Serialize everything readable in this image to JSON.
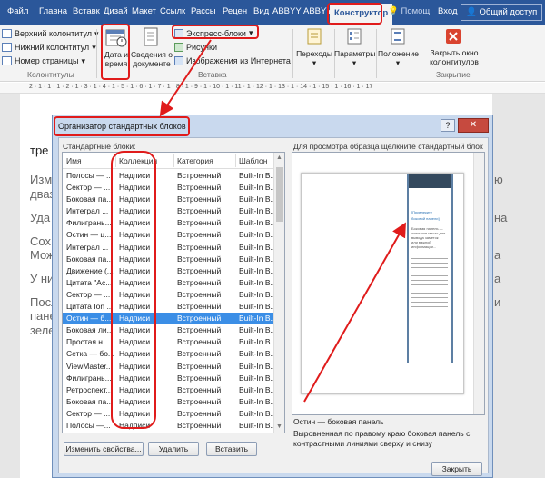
{
  "ribbon_tabs": [
    "Файл",
    "Главна",
    "Вставк",
    "Дизай",
    "Макет",
    "Ссылк",
    "Рассы",
    "Рецен",
    "Вид",
    "ABBYY",
    "ABBYY"
  ],
  "active_tab": "Конструктор",
  "help_label": "Помощ",
  "login_label": "Вход",
  "share_label": "Общий доступ",
  "header_footer": {
    "items": [
      "Верхний колонтитул",
      "Нижний колонтитул",
      "Номер страницы"
    ],
    "group_label": "Колонтитулы"
  },
  "insert_group": {
    "date_time": "Дата и\nвремя",
    "doc_info": "Сведения о\nдокументе",
    "express_blocks": "Экспресс-блоки",
    "pictures": "Рисунки",
    "online_pictures": "Изображения из Интернета",
    "group_label": "Вставка"
  },
  "nav_group": {
    "label": "Переходы"
  },
  "params_group": {
    "label": "Параметры"
  },
  "position_group": {
    "label": "Положение"
  },
  "close_group": {
    "label": "Закрыть окно\nколонтитулов",
    "group_label": "Закрытие"
  },
  "ruler": "2 · 1 · 1 · 1 · 2 · 1 · 3 · 1 · 4 · 1 · 5 · 1 · 6 · 1 · 7 · 1 · 8 · 1 · 9 · 1 · 10 · 1 · 11 · 1 · 12 · 1 · 13 · 1 · 14 · 1 · 15 · 1 · 16 · 1 · 17",
  "doc_lines": {
    "left": [
      "тре",
      "Изм",
      "дваз",
      "Уда",
      "Сох",
      "Мож",
      "У ни",
      "Посл",
      "пане",
      "зеле"
    ],
    "right": [
      "ю",
      "на",
      "а",
      "a",
      "и"
    ]
  },
  "dialog": {
    "title": "Организатор стандартных блоков",
    "help_btn": "?",
    "close_btn": "✕",
    "list_label": "Стандартные блоки:",
    "columns": [
      "Имя",
      "Коллекция",
      "Категория",
      "Шаблон"
    ],
    "rows": [
      [
        "Полосы — ...",
        "Надписи",
        "Встроенный",
        "Built-In B..."
      ],
      [
        "Сектор — ...",
        "Надписи",
        "Встроенный",
        "Built-In B..."
      ],
      [
        "Боковая па...",
        "Надписи",
        "Встроенный",
        "Built-In B..."
      ],
      [
        "Интеграл ...",
        "Надписи",
        "Встроенный",
        "Built-In B..."
      ],
      [
        "Филигрань...",
        "Надписи",
        "Встроенный",
        "Built-In B..."
      ],
      [
        "Остин — ц...",
        "Надписи",
        "Встроенный",
        "Built-In B..."
      ],
      [
        "Интеграл ...",
        "Надписи",
        "Встроенный",
        "Built-In B..."
      ],
      [
        "Боковая па...",
        "Надписи",
        "Встроенный",
        "Built-In B..."
      ],
      [
        "Движение (...",
        "Надписи",
        "Встроенный",
        "Built-In B..."
      ],
      [
        "Цитата \"Ас...",
        "Надписи",
        "Встроенный",
        "Built-In B..."
      ],
      [
        "Сектор — ...",
        "Надписи",
        "Встроенный",
        "Built-In B..."
      ],
      [
        "Цитата Ion ...",
        "Надписи",
        "Встроенный",
        "Built-In B..."
      ],
      [
        "Остин — б...",
        "Надписи",
        "Встроенный",
        "Built-In B..."
      ],
      [
        "Боковая ли...",
        "Надписи",
        "Встроенный",
        "Built-In B..."
      ],
      [
        "Простая н...",
        "Надписи",
        "Встроенный",
        "Built-In B..."
      ],
      [
        "Сетка — бо...",
        "Надписи",
        "Встроенный",
        "Built-In B..."
      ],
      [
        "ViewMaster...",
        "Надписи",
        "Встроенный",
        "Built-In B..."
      ],
      [
        "Филигрань...",
        "Надписи",
        "Встроенный",
        "Built-In B..."
      ],
      [
        "Ретроспект...",
        "Надписи",
        "Встроенный",
        "Built-In B..."
      ],
      [
        "Боковая па...",
        "Надписи",
        "Встроенный",
        "Built-In B..."
      ],
      [
        "Сектор — ...",
        "Надписи",
        "Встроенный",
        "Built-In B..."
      ],
      [
        "Полосы —...",
        "Надписи",
        "Встроенный",
        "Built-In B..."
      ]
    ],
    "selected_row": 12,
    "preview_label": "Для просмотра образца щелкните стандартный блок",
    "preview_sidebar_texts": [
      "[Привлеките",
      "боковой панели]",
      "Боковая панель —",
      "отличное место для",
      "вывода заметок",
      "или важной",
      "информации..."
    ],
    "selected_name": "Остин — боковая панель",
    "selected_desc": "Выровненная по правому краю боковая панель с контрастными линиями сверху и снизу",
    "buttons": {
      "edit": "Изменить свойства...",
      "delete": "Удалить",
      "insert": "Вставить",
      "close": "Закрыть"
    }
  },
  "annotation_color": "#e01b1b",
  "selection_color": "#3b8ee6"
}
